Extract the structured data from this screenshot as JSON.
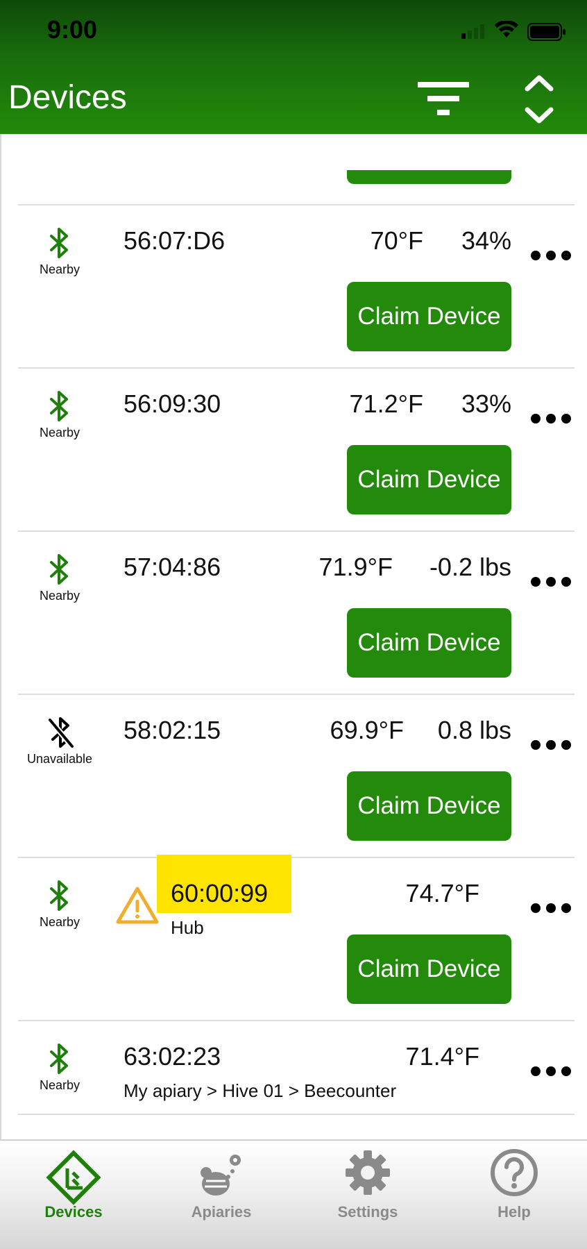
{
  "status_bar": {
    "time": "9:00"
  },
  "header": {
    "title": "Devices"
  },
  "colors": {
    "accent": "#238a0b",
    "highlight": "#ffe400",
    "warning": "#f0ad2f"
  },
  "devices": [
    {
      "status": "Nearby",
      "id": "56:07:D6",
      "temperature": "70°F",
      "metric": "34%",
      "subline": "",
      "action": "Claim Device"
    },
    {
      "status": "Nearby",
      "id": "56:09:30",
      "temperature": "71.2°F",
      "metric": "33%",
      "subline": "",
      "action": "Claim Device"
    },
    {
      "status": "Nearby",
      "id": "57:04:86",
      "temperature": "71.9°F",
      "metric": "-0.2 lbs",
      "subline": "",
      "action": "Claim Device"
    },
    {
      "status": "Unavailable",
      "id": "58:02:15",
      "temperature": "69.9°F",
      "metric": "0.8 lbs",
      "subline": "",
      "action": "Claim Device"
    },
    {
      "status": "Nearby",
      "id": "60:00:99",
      "temperature": "74.7°F",
      "metric": "",
      "subline": "Hub",
      "action": "Claim Device",
      "warning": true,
      "highlighted": true
    },
    {
      "status": "Nearby",
      "id": "63:02:23",
      "temperature": "71.4°F",
      "metric": "",
      "subline": "My apiary > Hive 01 > Beecounter"
    }
  ],
  "tabs": [
    {
      "label": "Devices",
      "icon": "devices-icon",
      "active": true
    },
    {
      "label": "Apiaries",
      "icon": "apiary-icon",
      "active": false
    },
    {
      "label": "Settings",
      "icon": "gear-icon",
      "active": false
    },
    {
      "label": "Help",
      "icon": "help-icon",
      "active": false
    }
  ]
}
